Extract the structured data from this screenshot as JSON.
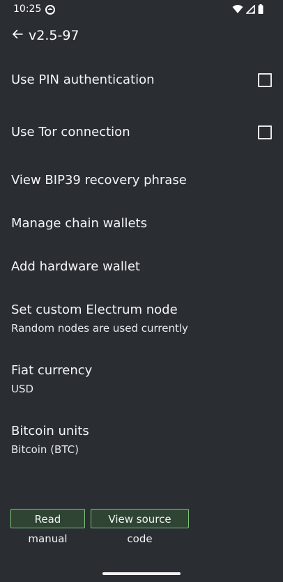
{
  "status_bar": {
    "time": "10:25"
  },
  "header": {
    "title": "v2.5-97"
  },
  "settings": {
    "pin": {
      "title": "Use PIN authentication",
      "checked": false
    },
    "tor": {
      "title": "Use Tor connection",
      "checked": false
    },
    "bip39": {
      "title": "View BIP39 recovery phrase"
    },
    "chain_wallets": {
      "title": "Manage chain wallets"
    },
    "hardware_wallet": {
      "title": "Add hardware wallet"
    },
    "electrum": {
      "title": "Set custom Electrum node",
      "subtitle": "Random nodes are used currently"
    },
    "fiat": {
      "title": "Fiat currency",
      "subtitle": "USD"
    },
    "units": {
      "title": "Bitcoin units",
      "subtitle": "Bitcoin (BTC)"
    }
  },
  "buttons": {
    "read_manual": "Read manual",
    "view_source": "View source code"
  },
  "colors": {
    "background": "#2a2e33",
    "accent_border": "#7dc47a",
    "button_fill": "#2f4433"
  }
}
